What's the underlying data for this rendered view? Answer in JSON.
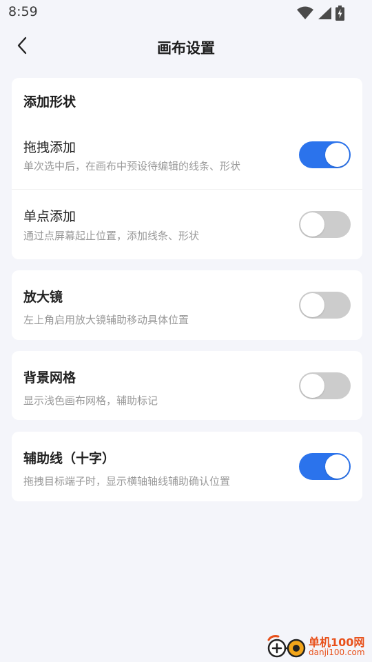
{
  "status_bar": {
    "time": "8:59",
    "icons": [
      "wifi-icon",
      "signal-icon",
      "battery-charging-icon"
    ]
  },
  "header": {
    "title": "画布设置",
    "back_icon": "chevron-left-icon"
  },
  "sections": [
    {
      "header": "添加形状",
      "rows": [
        {
          "title": "拖拽添加",
          "description": "单次选中后，在画布中预设待编辑的线条、形状",
          "enabled": true
        },
        {
          "title": "单点添加",
          "description": "通过点屏幕起止位置，添加线条、形状",
          "enabled": false
        }
      ]
    },
    {
      "rows": [
        {
          "title": "放大镜",
          "description": "左上角启用放大镜辅助移动具体位置",
          "enabled": false
        }
      ]
    },
    {
      "rows": [
        {
          "title": "背景网格",
          "description": "显示浅色画布网格，辅助标记",
          "enabled": false
        }
      ]
    },
    {
      "rows": [
        {
          "title": "辅助线（十字）",
          "description": "拖拽目标端子时，显示横轴轴线辅助确认位置",
          "enabled": true
        }
      ]
    }
  ],
  "watermark": {
    "name": "单机100网",
    "url": "danji100.com"
  },
  "colors": {
    "accent": "#2b73ec",
    "toggle_off": "#cccccc",
    "background": "#f4f5fa",
    "watermark": "#e8501a"
  }
}
